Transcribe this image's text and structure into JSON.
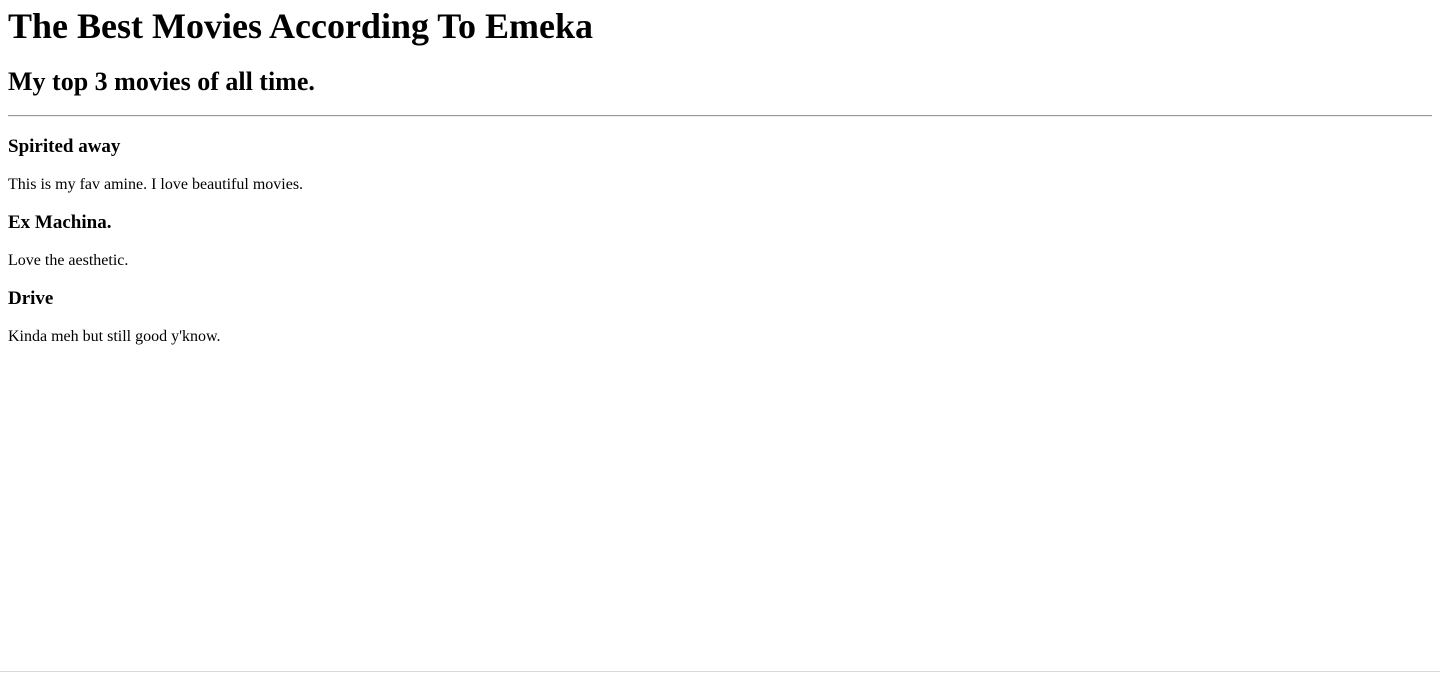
{
  "page": {
    "title": "The Best Movies According To Emeka",
    "subtitle": "My top 3 movies of all time."
  },
  "movies": [
    {
      "title": "Spirited away",
      "description": "This is my fav amine. I love beautiful movies."
    },
    {
      "title": "Ex Machina.",
      "description": "Love the aesthetic."
    },
    {
      "title": "Drive",
      "description": "Kinda meh but still good y'know."
    }
  ]
}
